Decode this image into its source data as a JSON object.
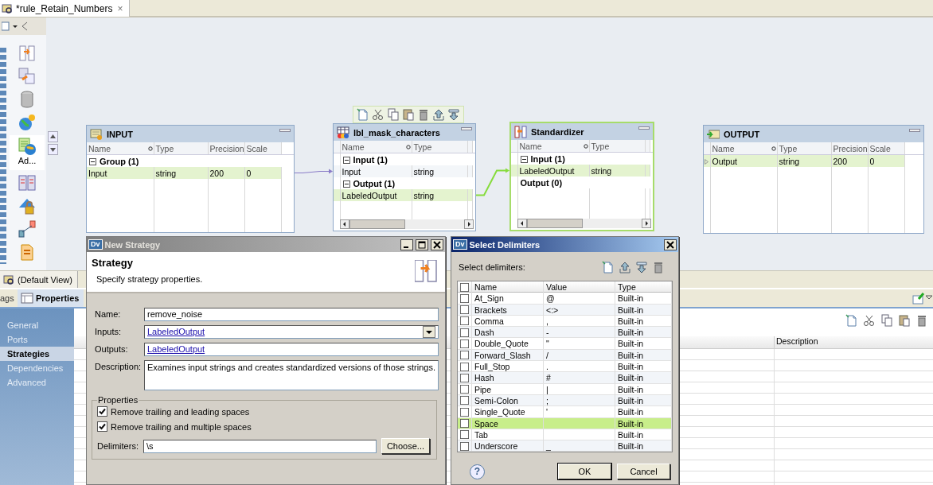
{
  "editor_tab": {
    "title": "*rule_Retain_Numbers",
    "close": "×"
  },
  "palette": {
    "items": [
      {
        "selected": false
      },
      {
        "selected": false
      },
      {
        "selected": false
      },
      {
        "selected": false
      },
      {
        "selected": true,
        "label": "Ad..."
      },
      {
        "selected": false
      },
      {
        "selected": false
      },
      {
        "selected": false
      },
      {
        "selected": false
      }
    ]
  },
  "canvas": {
    "nodes": [
      {
        "kind": "input",
        "title": "INPUT",
        "selected": false,
        "columns": [
          "Name",
          "Type",
          "Precision",
          "Scale"
        ],
        "rows": [
          {
            "kind": "group",
            "label": "Group (1)",
            "expanded": true
          },
          {
            "kind": "port",
            "cells": [
              "Input",
              "string",
              "200",
              "0"
            ],
            "selected": true
          }
        ]
      },
      {
        "kind": "mapplet",
        "title": "lbl_mask_characters",
        "selected": false,
        "columns": [
          "Name",
          "Type"
        ],
        "rows": [
          {
            "kind": "group",
            "label": "Input (1)",
            "expanded": true
          },
          {
            "kind": "port",
            "cells": [
              "Input",
              "string"
            ],
            "selected": false
          },
          {
            "kind": "group",
            "label": "Output (1)",
            "expanded": true
          },
          {
            "kind": "port",
            "cells": [
              "LabeledOutput",
              "string"
            ],
            "selected": true
          }
        ]
      },
      {
        "kind": "standardizer",
        "title": "Standardizer",
        "selected": true,
        "columns": [
          "Name",
          "Type"
        ],
        "rows": [
          {
            "kind": "group",
            "label": "Input (1)",
            "expanded": true
          },
          {
            "kind": "port",
            "cells": [
              "LabeledOutput",
              "string"
            ],
            "selected": true
          },
          {
            "kind": "empty_group",
            "label": "Output (0)"
          }
        ]
      },
      {
        "kind": "output",
        "title": "OUTPUT",
        "selected": false,
        "columns": [
          "Name",
          "Type",
          "Precision",
          "Scale"
        ],
        "rows": [
          {
            "kind": "port",
            "cells": [
              "Output",
              "string",
              "200",
              "0"
            ],
            "selected": true
          }
        ]
      }
    ],
    "links": [
      {
        "selected": false
      },
      {
        "selected": true
      }
    ]
  },
  "view_bar": {
    "label": "(Default View)"
  },
  "properties_view": {
    "tabs": [
      {
        "label": "ags",
        "selected": false
      },
      {
        "label": "Properties",
        "selected": true
      }
    ],
    "nav": [
      {
        "label": "General",
        "selected": false
      },
      {
        "label": "Ports",
        "selected": false
      },
      {
        "label": "Strategies",
        "selected": true
      },
      {
        "label": "Dependencies",
        "selected": false
      },
      {
        "label": "Advanced",
        "selected": false
      }
    ],
    "table": {
      "columns": [
        "Description"
      ]
    }
  },
  "new_strategy_dialog": {
    "icon_text": "Dv",
    "title": "New Strategy",
    "active": false,
    "heading": "Strategy",
    "subheading": "Specify strategy properties.",
    "fields": [
      {
        "kind": "text",
        "label": "Name:",
        "value": "remove_noise",
        "link": false
      },
      {
        "kind": "dropdown",
        "label": "Inputs:",
        "value": "LabeledOutput",
        "link": true
      },
      {
        "kind": "text",
        "label": "Outputs:",
        "value": "LabeledOutput",
        "link": true
      },
      {
        "kind": "textarea",
        "label": "Description:",
        "value": "Examines input strings and creates standardized versions of those strings.",
        "link": false
      }
    ],
    "properties": {
      "legend": "Properties",
      "options": [
        {
          "label": "Remove trailing and leading spaces",
          "checked": true
        },
        {
          "label": "Remove trailing and multiple spaces",
          "checked": true
        }
      ],
      "delimiters": {
        "label": "Delimiters:",
        "value": "\\s",
        "button": "Choose..."
      }
    }
  },
  "select_delimiters_dialog": {
    "icon_text": "Dv",
    "title": "Select Delimiters",
    "active": true,
    "prompt": "Select delimiters:",
    "all_checked": false,
    "columns": [
      "Name",
      "Value",
      "Type"
    ],
    "rows": [
      {
        "name": "At_Sign",
        "value": "@",
        "type": "Built-in",
        "checked": false,
        "selected": false
      },
      {
        "name": "Brackets",
        "value": "<:>",
        "type": "Built-in",
        "checked": false,
        "selected": false
      },
      {
        "name": "Comma",
        "value": ",",
        "type": "Built-in",
        "checked": false,
        "selected": false
      },
      {
        "name": "Dash",
        "value": "-",
        "type": "Built-in",
        "checked": false,
        "selected": false
      },
      {
        "name": "Double_Quote",
        "value": "\"",
        "type": "Built-in",
        "checked": false,
        "selected": false
      },
      {
        "name": "Forward_Slash",
        "value": "/",
        "type": "Built-in",
        "checked": false,
        "selected": false
      },
      {
        "name": "Full_Stop",
        "value": ".",
        "type": "Built-in",
        "checked": false,
        "selected": false
      },
      {
        "name": "Hash",
        "value": "#",
        "type": "Built-in",
        "checked": false,
        "selected": false
      },
      {
        "name": "Pipe",
        "value": "|",
        "type": "Built-in",
        "checked": false,
        "selected": false
      },
      {
        "name": "Semi-Colon",
        "value": ";",
        "type": "Built-in",
        "checked": false,
        "selected": false
      },
      {
        "name": "Single_Quote",
        "value": "'",
        "type": "Built-in",
        "checked": false,
        "selected": false
      },
      {
        "name": "Space",
        "type": "Built-in",
        "checked": false,
        "selected": true
      },
      {
        "name": "Tab",
        "type": "Built-in",
        "checked": false,
        "selected": false
      },
      {
        "name": "Underscore",
        "value": "_",
        "type": "Built-in",
        "checked": false,
        "selected": false
      }
    ],
    "help": "?",
    "buttons": [
      "OK",
      "Cancel"
    ]
  }
}
